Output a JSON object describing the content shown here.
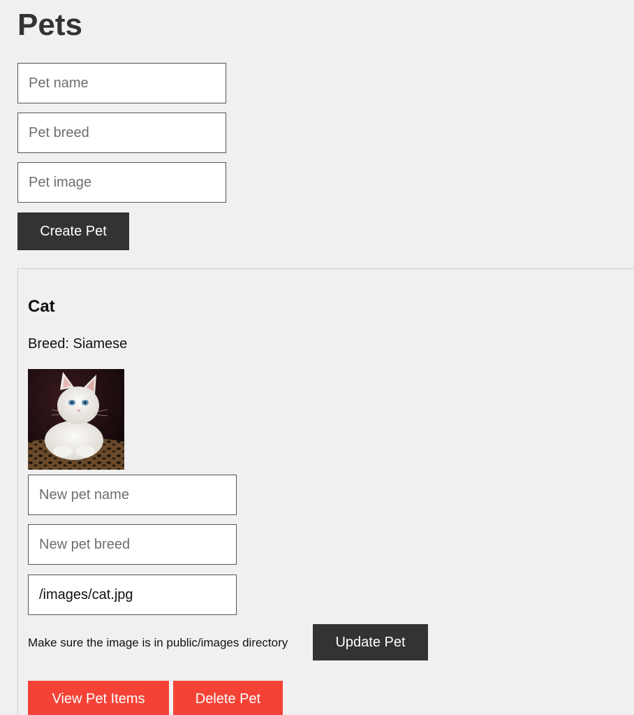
{
  "header": {
    "title": "Pets"
  },
  "create_form": {
    "name_placeholder": "Pet name",
    "breed_placeholder": "Pet breed",
    "image_placeholder": "Pet image",
    "submit_label": "Create Pet"
  },
  "pet": {
    "name": "Cat",
    "breed_text": "Breed: Siamese",
    "image_alt": "cat",
    "update_form": {
      "name_placeholder": "New pet name",
      "breed_placeholder": "New pet breed",
      "image_value": "/images/cat.jpg",
      "hint": "Make sure the image is in public/images directory",
      "update_label": "Update Pet"
    },
    "actions": {
      "view_items_label": "View Pet Items",
      "delete_label": "Delete Pet"
    }
  },
  "colors": {
    "background": "#f0f0f0",
    "dark_button": "#333333",
    "danger_button": "#f44336"
  }
}
